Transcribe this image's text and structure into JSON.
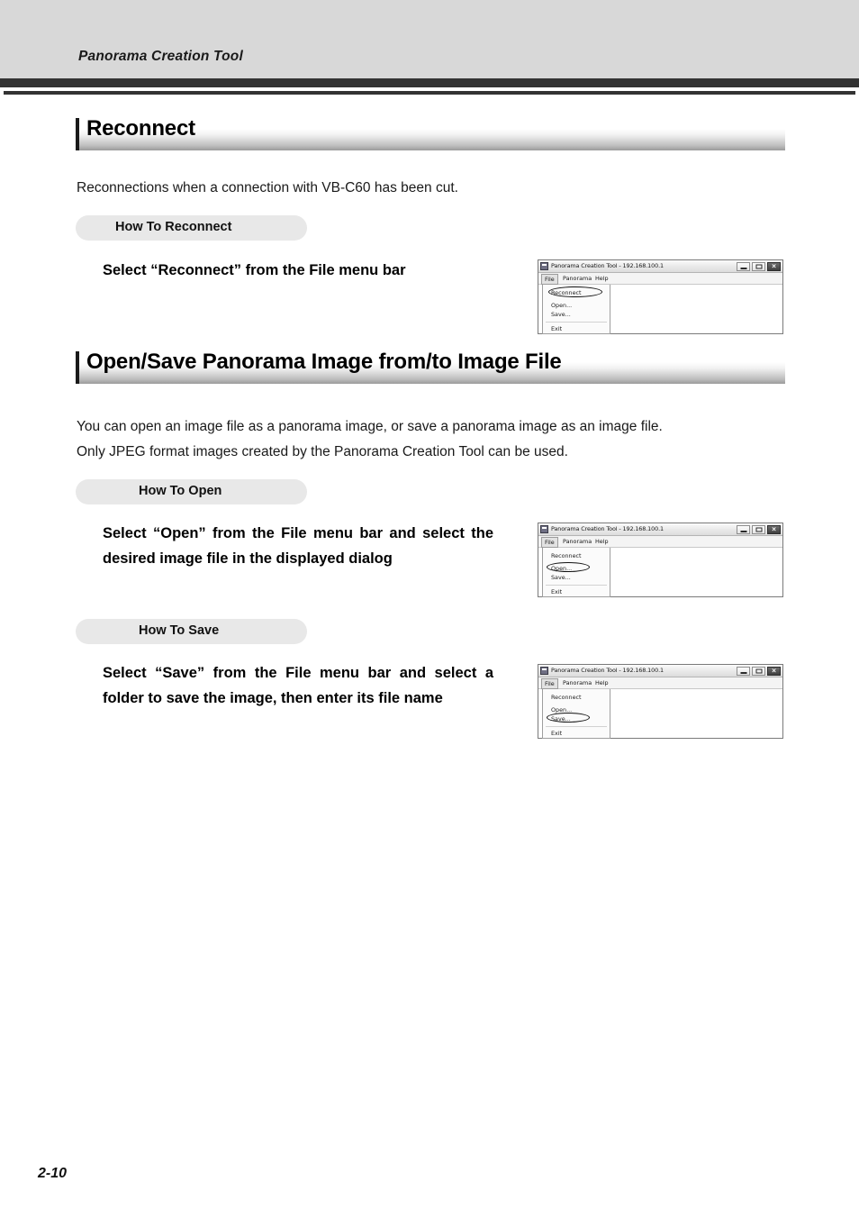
{
  "page": {
    "running_header": "Panorama Creation Tool",
    "page_number": "2-10"
  },
  "sections": [
    {
      "heading": "Reconnect",
      "intro": "Reconnections when a connection with VB-C60 has been cut.",
      "pill": "How To Reconnect",
      "instruction": "Select “Reconnect” from the File menu bar"
    },
    {
      "heading": "Open/Save Panorama Image from/to Image File",
      "intro_line1": "You can open an image file as a panorama image, or save a panorama image as an image file.",
      "intro_line2": "Only JPEG format images created by the Panorama Creation Tool can be used.",
      "pill_open": "How To Open",
      "instruction_open": "Select “Open” from the File menu bar and select the desired image file in the displayed dialog",
      "pill_save": "How To Save",
      "instruction_save": "Select “Save” from the File menu bar and select a folder to save the image, then enter its file name"
    }
  ],
  "dialog": {
    "title": "Panorama Creation Tool - 192.168.100.1",
    "menubar": {
      "file": "File",
      "panorama": "Panorama",
      "help": "Help"
    },
    "dropdown_items": {
      "reconnect": "Reconnect",
      "open": "Open...",
      "save": "Save...",
      "exit": "Exit"
    },
    "window_buttons": {
      "minimize": "minimize",
      "maximize": "maximize",
      "close": "×"
    }
  },
  "colors": {
    "header_band": "#d8d8d8",
    "rule": "#333333",
    "pill_bg": "#e8e8e8",
    "text": "#1a1a1a"
  }
}
